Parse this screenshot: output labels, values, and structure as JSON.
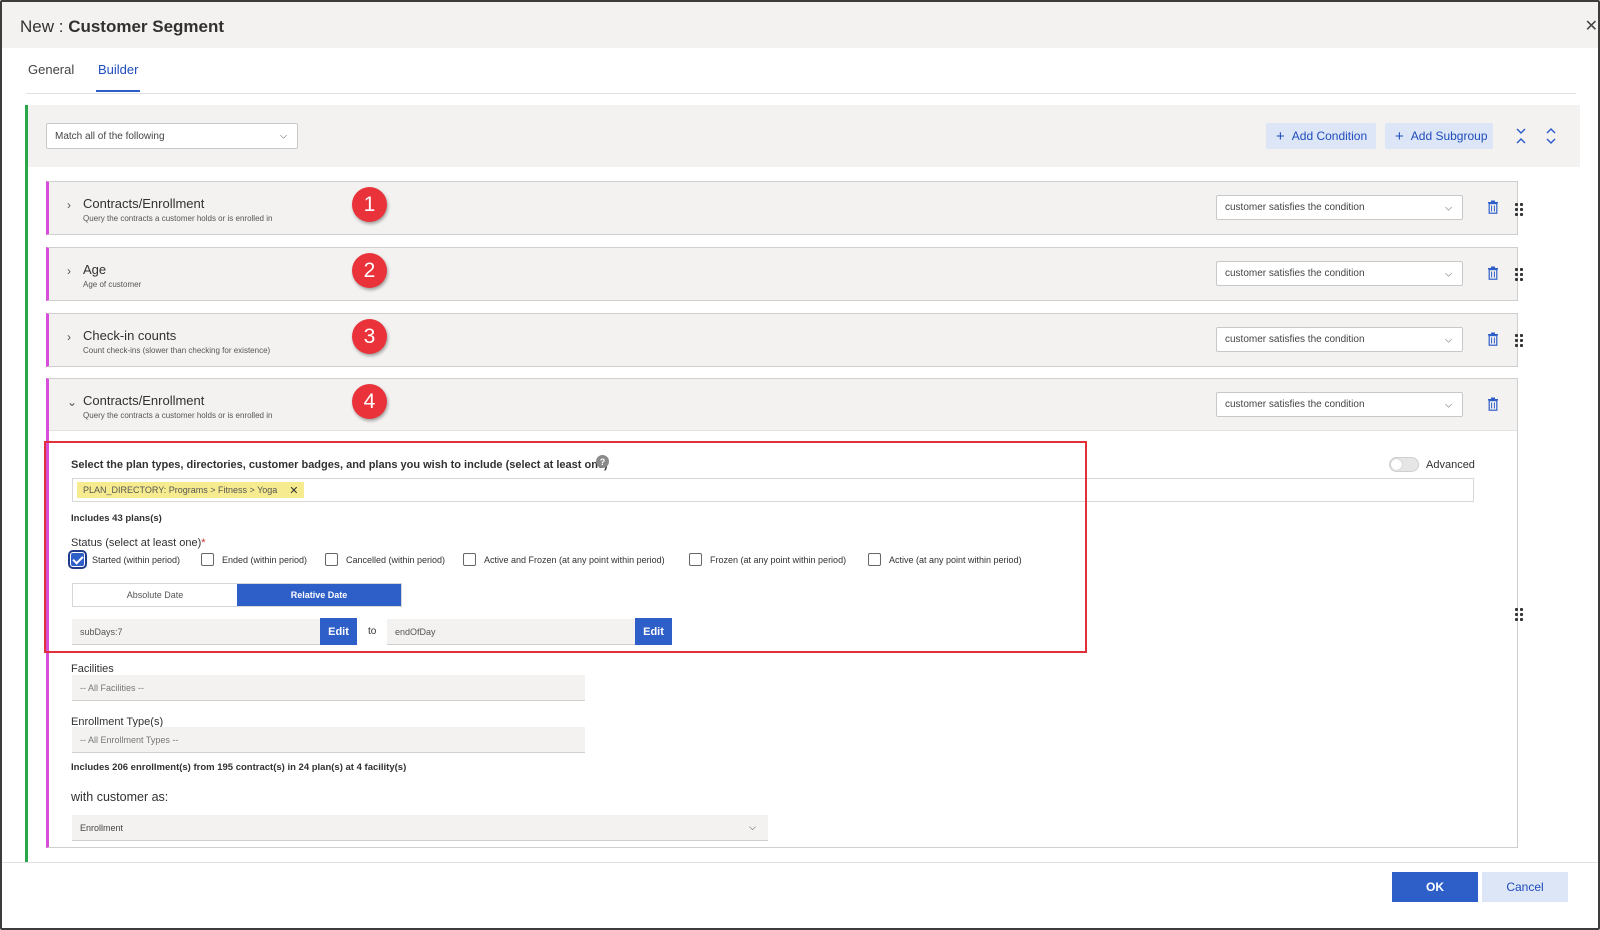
{
  "window": {
    "title_prefix": "New : ",
    "title": "Customer Segment",
    "close_glyph": "✕"
  },
  "tabs": [
    {
      "label": "General",
      "active": false
    },
    {
      "label": "Builder",
      "active": true
    }
  ],
  "builder": {
    "match_select": {
      "value": "Match all of the following"
    },
    "add_condition_label": "Add Condition",
    "add_subgroup_label": "Add Subgroup",
    "plus_glyph": "+",
    "icons": {
      "collapse_all": "collapse-all-icon",
      "expand_all": "expand-all-icon",
      "trash": "trash-icon",
      "drag": "drag-handle-icon",
      "chevron_right": "chevron-right-icon",
      "chevron_down": "chevron-down-icon"
    },
    "colors": {
      "accent": "#2e5ec8",
      "group_border": "#2aa74a",
      "condition_border": "#d74fd8",
      "badge": "#e9323a",
      "highlight": "#e0303a",
      "tag_bg": "#f6ec8f"
    },
    "conditions": [
      {
        "badge": "1",
        "title": "Contracts/Enrollment",
        "subtitle": "Query the contracts a customer holds or is enrolled in",
        "select": "customer satisfies the condition",
        "expanded": false
      },
      {
        "badge": "2",
        "title": "Age",
        "subtitle": "Age of customer",
        "select": "customer satisfies the condition",
        "expanded": false
      },
      {
        "badge": "3",
        "title": "Check-in counts",
        "subtitle": "Count check-ins (slower than checking for existence)",
        "select": "customer satisfies the condition",
        "expanded": false
      },
      {
        "badge": "4",
        "title": "Contracts/Enrollment",
        "subtitle": "Query the contracts a customer holds or is enrolled in",
        "select": "customer satisfies the condition",
        "expanded": true
      }
    ],
    "expanded": {
      "plans_label": "Select the plan types, directories, customer badges, and plans you wish to include (select at least one)",
      "help_glyph": "?",
      "advanced_label": "Advanced",
      "advanced_on": false,
      "tag": "PLAN_DIRECTORY: Programs > Fitness > Yoga",
      "tag_remove": "✕",
      "includes_plans": "Includes 43 plans(s)",
      "status_label": "Status (select at least one)",
      "required_mark": "*",
      "statuses": [
        {
          "label": "Started (within period)",
          "checked": true
        },
        {
          "label": "Ended (within period)",
          "checked": false
        },
        {
          "label": "Cancelled (within period)",
          "checked": false
        },
        {
          "label": "Active and Frozen (at any point within period)",
          "checked": false
        },
        {
          "label": "Frozen (at any point within period)",
          "checked": false
        },
        {
          "label": "Active (at any point within period)",
          "checked": false
        }
      ],
      "date_modes": {
        "absolute": "Absolute Date",
        "relative": "Relative Date",
        "selected": "Relative Date"
      },
      "from_value": "subDays:7",
      "to_label": "to",
      "to_value": "endOfDay",
      "edit_label": "Edit",
      "facilities_label": "Facilities",
      "facilities_placeholder": "-- All Facilities --",
      "enrollment_types_label": "Enrollment Type(s)",
      "enrollment_types_placeholder": "-- All Enrollment Types --",
      "summary": "Includes 206 enrollment(s) from 195 contract(s) in 24 plan(s) at 4 facility(s)",
      "with_customer_label": "with customer as:",
      "with_customer_value": "Enrollment"
    }
  },
  "footer": {
    "ok_label": "OK",
    "cancel_label": "Cancel"
  }
}
